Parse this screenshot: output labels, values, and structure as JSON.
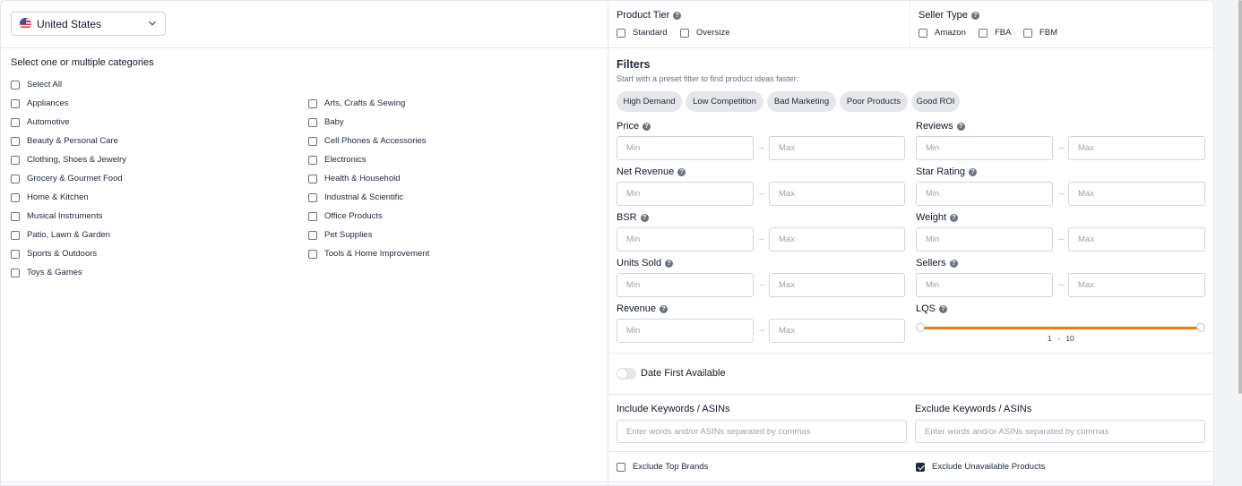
{
  "country": {
    "name": "United States"
  },
  "categories": {
    "title": "Select one or multiple categories",
    "select_all": "Select All",
    "left": [
      "Appliances",
      "Automotive",
      "Beauty & Personal Care",
      "Clothing, Shoes & Jewelry",
      "Grocery & Gourmet Food",
      "Home & Kitchen",
      "Musical Instruments",
      "Patio, Lawn & Garden",
      "Sports & Outdoors",
      "Toys & Games"
    ],
    "right": [
      "Arts, Crafts & Sewing",
      "Baby",
      "Cell Phones & Accessories",
      "Electronics",
      "Health & Household",
      "Industrial & Scientific",
      "Office Products",
      "Pet Supplies",
      "Tools & Home Improvement"
    ]
  },
  "product_tier": {
    "title": "Product Tier",
    "options": [
      "Standard",
      "Oversize"
    ]
  },
  "seller_type": {
    "title": "Seller Type",
    "options": [
      "Amazon",
      "FBA",
      "FBM"
    ]
  },
  "filters": {
    "title": "Filters",
    "subtitle": "Start with a preset filter to find product ideas faster:",
    "presets": [
      "High Demand",
      "Low Competition",
      "Bad Marketing",
      "Poor Products",
      "Good ROI"
    ],
    "min_placeholder": "Min",
    "max_placeholder": "Max",
    "left": [
      "Price",
      "Net Revenue",
      "BSR",
      "Units Sold",
      "Revenue"
    ],
    "right": [
      "Reviews",
      "Star Rating",
      "Weight",
      "Sellers",
      "LQS"
    ],
    "lqs": {
      "min": "1",
      "sep": "-",
      "max": "10"
    }
  },
  "date_first_available": {
    "label": "Date First Available",
    "enabled": false
  },
  "keywords": {
    "include_label": "Include Keywords / ASINs",
    "exclude_label": "Exclude Keywords / ASINs",
    "placeholder": "Enter words and/or ASINs separated by commas"
  },
  "options": {
    "exclude_top_brands": {
      "label": "Exclude Top Brands",
      "checked": false
    },
    "exclude_unavailable": {
      "label": "Exclude Unavailable Products",
      "checked": true
    }
  },
  "icons": {
    "help": "question-circle-icon",
    "chevron": "chevron-down-icon",
    "flag": "us-flag-icon",
    "arrow": "arrow-right-icon"
  },
  "colors": {
    "slider": "#ea7a1c",
    "chip_bg": "#e5e7eb"
  }
}
